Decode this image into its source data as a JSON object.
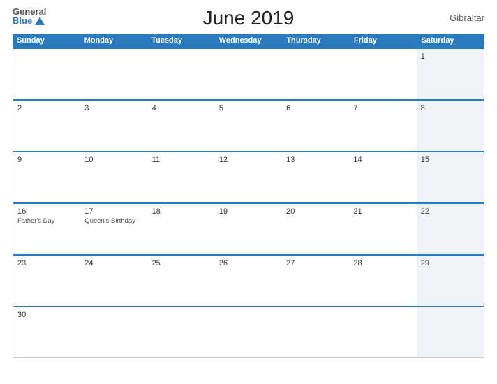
{
  "header": {
    "title": "June 2019",
    "country": "Gibraltar",
    "logo_general": "General",
    "logo_blue": "Blue"
  },
  "day_headers": [
    "Sunday",
    "Monday",
    "Tuesday",
    "Wednesday",
    "Thursday",
    "Friday",
    "Saturday"
  ],
  "weeks": [
    [
      {
        "date": "",
        "event": ""
      },
      {
        "date": "",
        "event": ""
      },
      {
        "date": "",
        "event": ""
      },
      {
        "date": "",
        "event": ""
      },
      {
        "date": "",
        "event": ""
      },
      {
        "date": "",
        "event": ""
      },
      {
        "date": "1",
        "event": ""
      }
    ],
    [
      {
        "date": "2",
        "event": ""
      },
      {
        "date": "3",
        "event": ""
      },
      {
        "date": "4",
        "event": ""
      },
      {
        "date": "5",
        "event": ""
      },
      {
        "date": "6",
        "event": ""
      },
      {
        "date": "7",
        "event": ""
      },
      {
        "date": "8",
        "event": ""
      }
    ],
    [
      {
        "date": "9",
        "event": ""
      },
      {
        "date": "10",
        "event": ""
      },
      {
        "date": "11",
        "event": ""
      },
      {
        "date": "12",
        "event": ""
      },
      {
        "date": "13",
        "event": ""
      },
      {
        "date": "14",
        "event": ""
      },
      {
        "date": "15",
        "event": ""
      }
    ],
    [
      {
        "date": "16",
        "event": "Father's Day"
      },
      {
        "date": "17",
        "event": "Queen's Birthday"
      },
      {
        "date": "18",
        "event": ""
      },
      {
        "date": "19",
        "event": ""
      },
      {
        "date": "20",
        "event": ""
      },
      {
        "date": "21",
        "event": ""
      },
      {
        "date": "22",
        "event": ""
      }
    ],
    [
      {
        "date": "23",
        "event": ""
      },
      {
        "date": "24",
        "event": ""
      },
      {
        "date": "25",
        "event": ""
      },
      {
        "date": "26",
        "event": ""
      },
      {
        "date": "27",
        "event": ""
      },
      {
        "date": "28",
        "event": ""
      },
      {
        "date": "29",
        "event": ""
      }
    ],
    [
      {
        "date": "30",
        "event": ""
      },
      {
        "date": "",
        "event": ""
      },
      {
        "date": "",
        "event": ""
      },
      {
        "date": "",
        "event": ""
      },
      {
        "date": "",
        "event": ""
      },
      {
        "date": "",
        "event": ""
      },
      {
        "date": "",
        "event": ""
      }
    ]
  ],
  "colors": {
    "header_bg": "#2a7abf",
    "border_top": "#2a7abf",
    "text_primary": "#333",
    "text_event": "#555",
    "sat_bg": "#f0f4f8"
  }
}
